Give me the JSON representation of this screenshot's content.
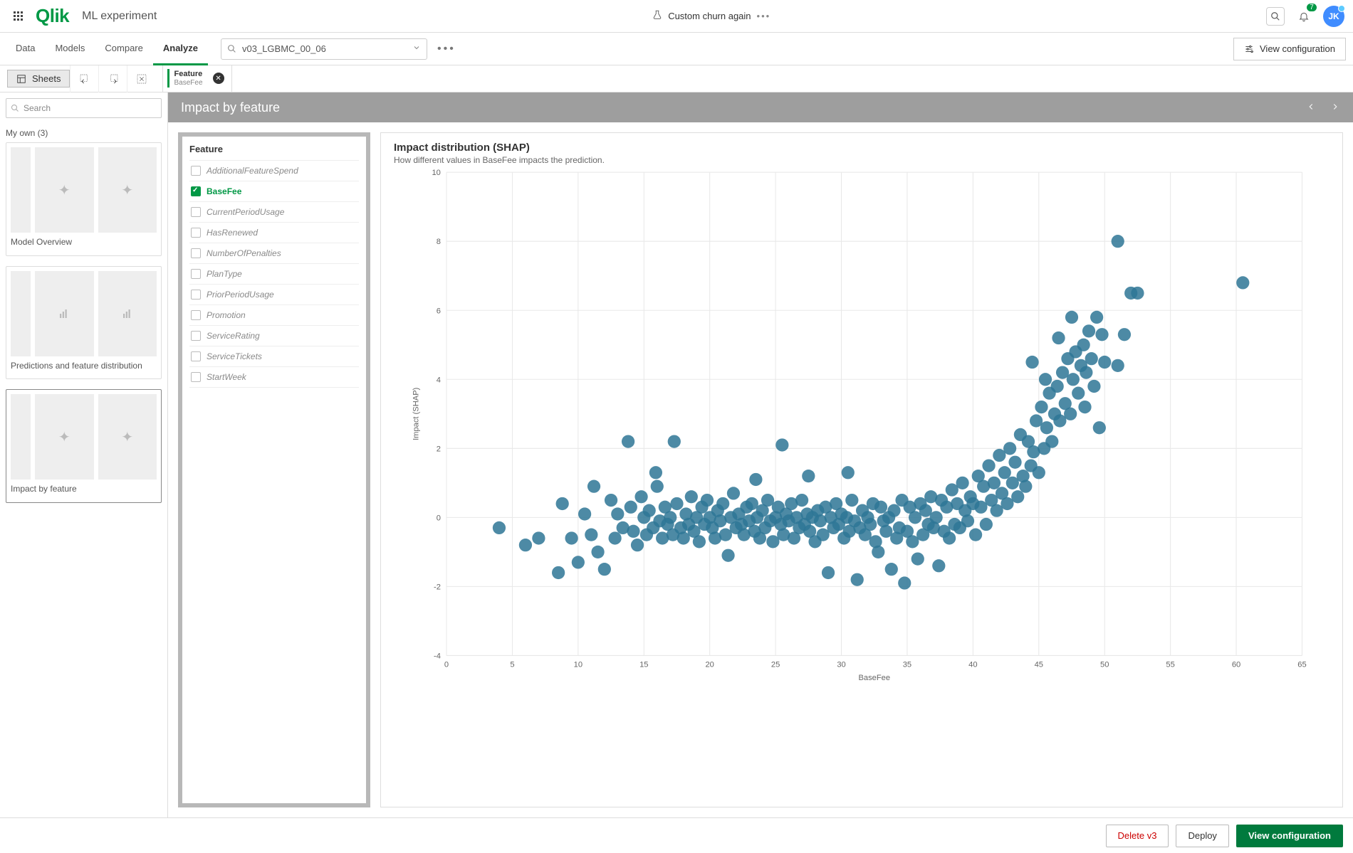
{
  "header": {
    "app_title": "ML experiment",
    "center_label": "Custom churn again",
    "notification_count": "7",
    "avatar_initials": "JK",
    "search_placeholder": "Search"
  },
  "tabs": [
    "Data",
    "Models",
    "Compare",
    "Analyze"
  ],
  "active_tab": 3,
  "model_selector": {
    "value": "v03_LGBMC_00_06"
  },
  "view_config_label": "View configuration",
  "sheets_label": "Sheets",
  "filter_pill": {
    "name": "Feature",
    "value": "BaseFee"
  },
  "left_search_placeholder": "Search",
  "my_own_label": "My own (3)",
  "sheet_cards": [
    {
      "title": "Model Overview"
    },
    {
      "title": "Predictions and feature distribution"
    },
    {
      "title": "Impact by feature"
    }
  ],
  "active_sheet": 2,
  "impact_header": "Impact by feature",
  "feature_panel_title": "Feature",
  "features": [
    {
      "label": "AdditionalFeatureSpend",
      "selected": false
    },
    {
      "label": "BaseFee",
      "selected": true
    },
    {
      "label": "CurrentPeriodUsage",
      "selected": false
    },
    {
      "label": "HasRenewed",
      "selected": false
    },
    {
      "label": "NumberOfPenalties",
      "selected": false
    },
    {
      "label": "PlanType",
      "selected": false
    },
    {
      "label": "PriorPeriodUsage",
      "selected": false
    },
    {
      "label": "Promotion",
      "selected": false
    },
    {
      "label": "ServiceRating",
      "selected": false
    },
    {
      "label": "ServiceTickets",
      "selected": false
    },
    {
      "label": "StartWeek",
      "selected": false
    }
  ],
  "chart_title": "Impact distribution (SHAP)",
  "chart_subtitle": "How different values in BaseFee impacts the prediction.",
  "footer": {
    "delete": "Delete v3",
    "deploy": "Deploy",
    "view": "View configuration"
  },
  "chart_data": {
    "type": "scatter",
    "xlabel": "BaseFee",
    "ylabel": "Impact (SHAP)",
    "xlim": [
      0,
      65
    ],
    "ylim": [
      -4,
      10
    ],
    "xticks": [
      0,
      5,
      10,
      15,
      20,
      25,
      30,
      35,
      40,
      45,
      50,
      55,
      60,
      65
    ],
    "yticks": [
      -4,
      -2,
      0,
      2,
      4,
      6,
      8,
      10
    ],
    "point_color": "#2e7695",
    "points": [
      [
        4,
        -0.3
      ],
      [
        6,
        -0.8
      ],
      [
        7,
        -0.6
      ],
      [
        8.5,
        -1.6
      ],
      [
        8.8,
        0.4
      ],
      [
        9.5,
        -0.6
      ],
      [
        10,
        -1.3
      ],
      [
        10.5,
        0.1
      ],
      [
        11,
        -0.5
      ],
      [
        11.2,
        0.9
      ],
      [
        11.5,
        -1.0
      ],
      [
        12,
        -1.5
      ],
      [
        12.5,
        0.5
      ],
      [
        12.8,
        -0.6
      ],
      [
        13,
        0.1
      ],
      [
        13.4,
        -0.3
      ],
      [
        13.8,
        2.2
      ],
      [
        14,
        0.3
      ],
      [
        14.2,
        -0.4
      ],
      [
        14.5,
        -0.8
      ],
      [
        14.8,
        0.6
      ],
      [
        15,
        0.0
      ],
      [
        15.2,
        -0.5
      ],
      [
        15.4,
        0.2
      ],
      [
        15.7,
        -0.3
      ],
      [
        15.9,
        1.3
      ],
      [
        16,
        0.9
      ],
      [
        16.2,
        -0.1
      ],
      [
        16.4,
        -0.6
      ],
      [
        16.6,
        0.3
      ],
      [
        16.8,
        -0.2
      ],
      [
        17,
        0.0
      ],
      [
        17.2,
        -0.5
      ],
      [
        17.3,
        2.2
      ],
      [
        17.5,
        0.4
      ],
      [
        17.8,
        -0.3
      ],
      [
        18,
        -0.6
      ],
      [
        18.2,
        0.1
      ],
      [
        18.4,
        -0.2
      ],
      [
        18.6,
        0.6
      ],
      [
        18.8,
        -0.4
      ],
      [
        19,
        0.0
      ],
      [
        19.2,
        -0.7
      ],
      [
        19.4,
        0.3
      ],
      [
        19.6,
        -0.2
      ],
      [
        19.8,
        0.5
      ],
      [
        20,
        0.0
      ],
      [
        20.2,
        -0.3
      ],
      [
        20.4,
        -0.6
      ],
      [
        20.6,
        0.2
      ],
      [
        20.8,
        -0.1
      ],
      [
        21,
        0.4
      ],
      [
        21.2,
        -0.5
      ],
      [
        21.4,
        -1.1
      ],
      [
        21.6,
        0.0
      ],
      [
        21.8,
        0.7
      ],
      [
        22,
        -0.3
      ],
      [
        22.2,
        0.1
      ],
      [
        22.4,
        -0.2
      ],
      [
        22.6,
        -0.5
      ],
      [
        22.8,
        0.3
      ],
      [
        23,
        -0.1
      ],
      [
        23.2,
        0.4
      ],
      [
        23.4,
        -0.4
      ],
      [
        23.5,
        1.1
      ],
      [
        23.6,
        0.0
      ],
      [
        23.8,
        -0.6
      ],
      [
        24,
        0.2
      ],
      [
        24.2,
        -0.3
      ],
      [
        24.4,
        0.5
      ],
      [
        24.6,
        -0.1
      ],
      [
        24.8,
        -0.7
      ],
      [
        25,
        0.0
      ],
      [
        25.2,
        0.3
      ],
      [
        25.4,
        -0.2
      ],
      [
        25.5,
        2.1
      ],
      [
        25.6,
        -0.5
      ],
      [
        25.8,
        0.1
      ],
      [
        26,
        -0.1
      ],
      [
        26.2,
        0.4
      ],
      [
        26.4,
        -0.6
      ],
      [
        26.6,
        0.0
      ],
      [
        26.8,
        -0.3
      ],
      [
        27,
        0.5
      ],
      [
        27.2,
        -0.2
      ],
      [
        27.4,
        0.1
      ],
      [
        27.5,
        1.2
      ],
      [
        27.6,
        -0.4
      ],
      [
        27.8,
        0.0
      ],
      [
        28,
        -0.7
      ],
      [
        28.2,
        0.2
      ],
      [
        28.4,
        -0.1
      ],
      [
        28.6,
        -0.5
      ],
      [
        28.8,
        0.3
      ],
      [
        29,
        -1.6
      ],
      [
        29.2,
        0.0
      ],
      [
        29.4,
        -0.3
      ],
      [
        29.6,
        0.4
      ],
      [
        29.8,
        -0.2
      ],
      [
        30,
        0.1
      ],
      [
        30.2,
        -0.6
      ],
      [
        30.4,
        0.0
      ],
      [
        30.5,
        1.3
      ],
      [
        30.6,
        -0.4
      ],
      [
        30.8,
        0.5
      ],
      [
        31,
        -0.1
      ],
      [
        31.2,
        -1.8
      ],
      [
        31.4,
        -0.3
      ],
      [
        31.6,
        0.2
      ],
      [
        31.8,
        -0.5
      ],
      [
        32,
        0.0
      ],
      [
        32.2,
        -0.2
      ],
      [
        32.4,
        0.4
      ],
      [
        32.6,
        -0.7
      ],
      [
        32.8,
        -1.0
      ],
      [
        33,
        0.3
      ],
      [
        33.2,
        -0.1
      ],
      [
        33.4,
        -0.4
      ],
      [
        33.6,
        0.0
      ],
      [
        33.8,
        -1.5
      ],
      [
        34,
        0.2
      ],
      [
        34.2,
        -0.6
      ],
      [
        34.4,
        -0.3
      ],
      [
        34.6,
        0.5
      ],
      [
        34.8,
        -1.9
      ],
      [
        35,
        -0.4
      ],
      [
        35.2,
        0.3
      ],
      [
        35.4,
        -0.7
      ],
      [
        35.6,
        0.0
      ],
      [
        35.8,
        -1.2
      ],
      [
        36,
        0.4
      ],
      [
        36.2,
        -0.5
      ],
      [
        36.4,
        0.2
      ],
      [
        36.6,
        -0.2
      ],
      [
        36.8,
        0.6
      ],
      [
        37,
        -0.3
      ],
      [
        37.2,
        0.0
      ],
      [
        37.4,
        -1.4
      ],
      [
        37.6,
        0.5
      ],
      [
        37.8,
        -0.4
      ],
      [
        38,
        0.3
      ],
      [
        38.2,
        -0.6
      ],
      [
        38.4,
        0.8
      ],
      [
        38.6,
        -0.2
      ],
      [
        38.8,
        0.4
      ],
      [
        39,
        -0.3
      ],
      [
        39.2,
        1.0
      ],
      [
        39.4,
        0.2
      ],
      [
        39.6,
        -0.1
      ],
      [
        39.8,
        0.6
      ],
      [
        40,
        0.4
      ],
      [
        40.2,
        -0.5
      ],
      [
        40.4,
        1.2
      ],
      [
        40.6,
        0.3
      ],
      [
        40.8,
        0.9
      ],
      [
        41,
        -0.2
      ],
      [
        41.2,
        1.5
      ],
      [
        41.4,
        0.5
      ],
      [
        41.6,
        1.0
      ],
      [
        41.8,
        0.2
      ],
      [
        42,
        1.8
      ],
      [
        42.2,
        0.7
      ],
      [
        42.4,
        1.3
      ],
      [
        42.6,
        0.4
      ],
      [
        42.8,
        2.0
      ],
      [
        43,
        1.0
      ],
      [
        43.2,
        1.6
      ],
      [
        43.4,
        0.6
      ],
      [
        43.6,
        2.4
      ],
      [
        43.8,
        1.2
      ],
      [
        44,
        0.9
      ],
      [
        44.2,
        2.2
      ],
      [
        44.4,
        1.5
      ],
      [
        44.5,
        4.5
      ],
      [
        44.6,
        1.9
      ],
      [
        44.8,
        2.8
      ],
      [
        45,
        1.3
      ],
      [
        45.2,
        3.2
      ],
      [
        45.4,
        2.0
      ],
      [
        45.5,
        4.0
      ],
      [
        45.6,
        2.6
      ],
      [
        45.8,
        3.6
      ],
      [
        46,
        2.2
      ],
      [
        46.2,
        3.0
      ],
      [
        46.4,
        3.8
      ],
      [
        46.5,
        5.2
      ],
      [
        46.6,
        2.8
      ],
      [
        46.8,
        4.2
      ],
      [
        47,
        3.3
      ],
      [
        47.2,
        4.6
      ],
      [
        47.4,
        3.0
      ],
      [
        47.5,
        5.8
      ],
      [
        47.6,
        4.0
      ],
      [
        47.8,
        4.8
      ],
      [
        48,
        3.6
      ],
      [
        48.2,
        4.4
      ],
      [
        48.4,
        5.0
      ],
      [
        48.5,
        3.2
      ],
      [
        48.6,
        4.2
      ],
      [
        48.8,
        5.4
      ],
      [
        49,
        4.6
      ],
      [
        49.2,
        3.8
      ],
      [
        49.4,
        5.8
      ],
      [
        49.6,
        2.6
      ],
      [
        49.8,
        5.3
      ],
      [
        50,
        4.5
      ],
      [
        51,
        4.4
      ],
      [
        51.5,
        5.3
      ],
      [
        52,
        6.5
      ],
      [
        52.5,
        6.5
      ],
      [
        51,
        8.0
      ],
      [
        60.5,
        6.8
      ]
    ]
  }
}
